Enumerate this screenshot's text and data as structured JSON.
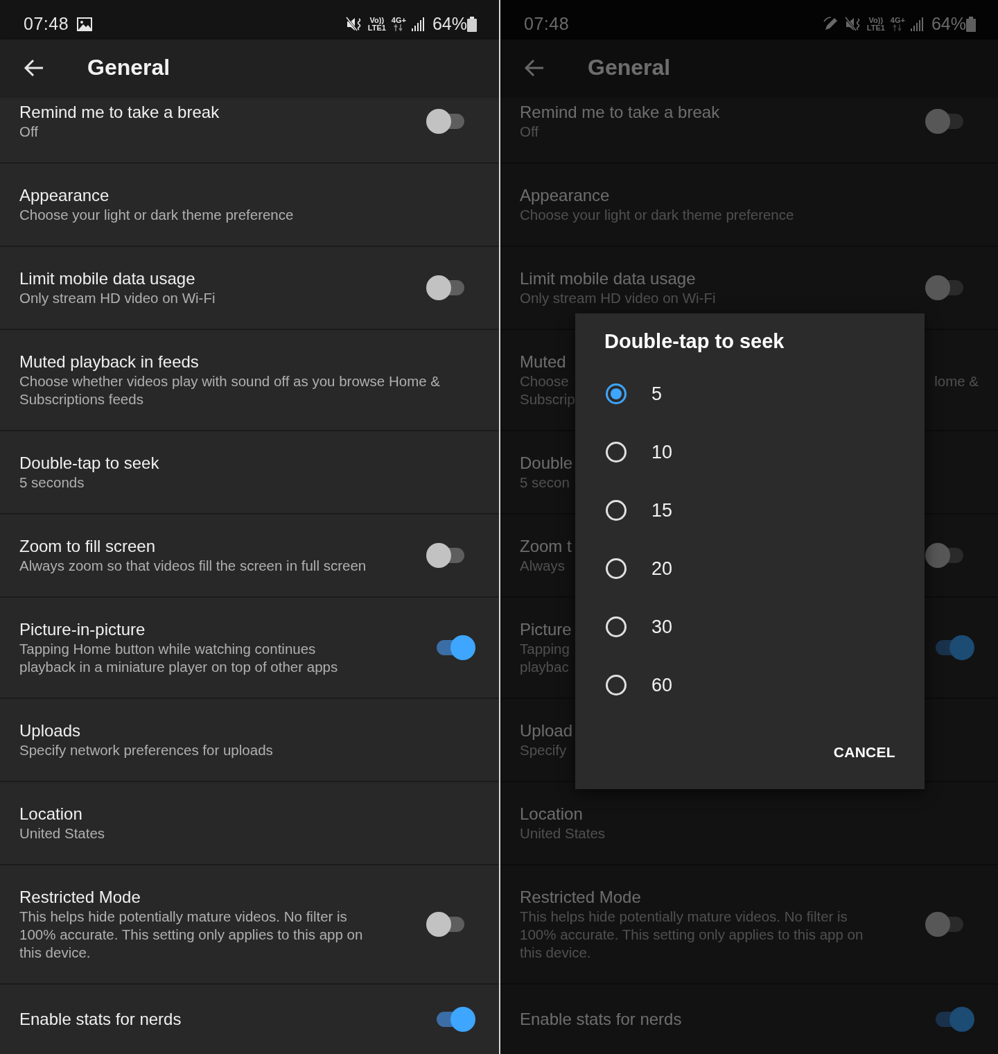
{
  "screens": [
    {
      "status_bar": {
        "time": "07:48",
        "notifications": [
          {
            "kind": "gallery"
          }
        ],
        "indicators": [
          {
            "kind": "mute"
          }
        ],
        "volte": "Vo))",
        "lte": "LTE1",
        "network": "4G+",
        "battery": "64%"
      },
      "header": {
        "title": "General"
      },
      "settings": [
        {
          "title": "Remind me to take a break",
          "subtitle": "Off",
          "kind": "toggle",
          "on": false
        },
        {
          "title": "Appearance",
          "subtitle": "Choose your light or dark theme preference",
          "kind": "plain"
        },
        {
          "title": "Limit mobile data usage",
          "subtitle": "Only stream HD video on Wi-Fi",
          "kind": "toggle",
          "on": false
        },
        {
          "title": "Muted playback in feeds",
          "subtitle": "Choose whether videos play with sound off as you browse Home &\nSubscriptions feeds",
          "kind": "plain"
        },
        {
          "title": "Double-tap to seek",
          "subtitle": "5 seconds",
          "kind": "plain"
        },
        {
          "title": "Zoom to fill screen",
          "subtitle": "Always zoom so that videos fill the screen in full screen",
          "kind": "toggle",
          "on": false
        },
        {
          "title": "Picture-in-picture",
          "subtitle": "Tapping Home button while watching continues\nplayback in a miniature player on top of other apps",
          "kind": "toggle",
          "on": true
        },
        {
          "title": "Uploads",
          "subtitle": "Specify network preferences for uploads",
          "kind": "plain"
        },
        {
          "title": "Location",
          "subtitle": "United States",
          "kind": "plain"
        },
        {
          "title": "Restricted Mode",
          "subtitle": "This helps hide potentially mature videos. No filter is\n100% accurate. This setting only applies to this app on\nthis device.",
          "kind": "toggle",
          "on": false
        },
        {
          "title": "Enable stats for nerds",
          "kind": "toggle",
          "on": true
        }
      ]
    },
    {
      "status_bar": {
        "time": "07:48",
        "indicators": [
          {
            "kind": "wifi-call"
          },
          {
            "kind": "mute"
          }
        ],
        "volte": "Vo))",
        "lte": "LTE1",
        "network": "4G+",
        "battery": "64%"
      },
      "header": {
        "title": "General"
      },
      "settings": [
        {
          "title": "Remind me to take a break",
          "subtitle": "Off",
          "kind": "toggle",
          "on": false
        },
        {
          "title": "Appearance",
          "subtitle": "Choose your light or dark theme preference",
          "kind": "plain"
        },
        {
          "title": "Limit mobile data usage",
          "subtitle": "Only stream HD video on Wi-Fi",
          "kind": "toggle",
          "on": false
        },
        {
          "title": "Muted",
          "subtitle": "Choose\nSubscrip",
          "subtitle_right": "lome &",
          "kind": "plain"
        },
        {
          "title": "Double",
          "subtitle": "5 secon",
          "kind": "plain"
        },
        {
          "title": "Zoom t",
          "subtitle": "Always",
          "kind": "toggle",
          "on": false
        },
        {
          "title": "Picture",
          "subtitle": "Tapping\nplaybac",
          "kind": "toggle",
          "on": true
        },
        {
          "title": "Upload",
          "subtitle": "Specify",
          "kind": "plain"
        },
        {
          "title": "Location",
          "subtitle": "United States",
          "kind": "plain"
        },
        {
          "title": "Restricted Mode",
          "subtitle": "This helps hide potentially mature videos. No filter is\n100% accurate. This setting only applies to this app on\nthis device.",
          "kind": "toggle",
          "on": false
        },
        {
          "title": "Enable stats for nerds",
          "kind": "toggle",
          "on": true
        }
      ],
      "dialog": {
        "title": "Double-tap to seek",
        "options": [
          {
            "label": "5",
            "selected": true
          },
          {
            "label": "10",
            "selected": false
          },
          {
            "label": "15",
            "selected": false
          },
          {
            "label": "20",
            "selected": false
          },
          {
            "label": "30",
            "selected": false
          },
          {
            "label": "60",
            "selected": false
          }
        ],
        "cancel": "CANCEL"
      }
    }
  ]
}
